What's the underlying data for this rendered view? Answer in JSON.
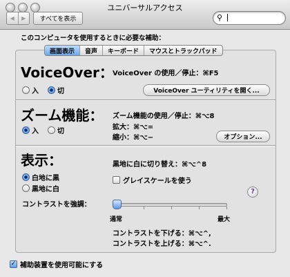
{
  "window": {
    "title": "ユニバーサルアクセス"
  },
  "toolbar": {
    "back_icon": "◀",
    "forward_icon": "▶",
    "show_all": "すべてを表示",
    "search_value": ""
  },
  "intro": "このコンピュータを使用するときに必要な補助：",
  "tabs": [
    {
      "label": "画面表示",
      "active": true
    },
    {
      "label": "音声",
      "active": false
    },
    {
      "label": "キーボード",
      "active": false
    },
    {
      "label": "マウスとトラックパッド",
      "active": false
    }
  ],
  "voiceover": {
    "title": "VoiceOver：",
    "shortcut": "VoiceOver の使用／停止：⌘F5",
    "on_label": "入",
    "off_label": "切",
    "selected": "off",
    "utility_button": "VoiceOver ユーティリティを開く..."
  },
  "zoom": {
    "title": "ズーム機能：",
    "toggle_shortcut": "ズーム機能の使用／停止：⌘⌥8",
    "zoom_in": "拡大：⌘⌥=",
    "zoom_out": "縮小：⌘⌥−",
    "on_label": "入",
    "off_label": "切",
    "selected": "on",
    "options_button": "オプション..."
  },
  "display": {
    "title": "表示：",
    "black_on_white": "白地に黒",
    "white_on_black": "黒地に白",
    "selected": "black_on_white",
    "switch_shortcut": "黒地に白に切り替え：⌘⌥^8",
    "grayscale_label": "グレイスケールを使う",
    "grayscale_checked": false,
    "contrast_label": "コントラストを強調：",
    "contrast_min": "通常",
    "contrast_max": "最大",
    "contrast_value": 0,
    "contrast_down": "コントラストを下げる：⌘⌥^,",
    "contrast_up": "コントラストを上げる：⌘⌥^."
  },
  "help_icon": "?",
  "footer": {
    "assistive_label": "補助装置を使用可能にする",
    "assistive_checked": true
  }
}
